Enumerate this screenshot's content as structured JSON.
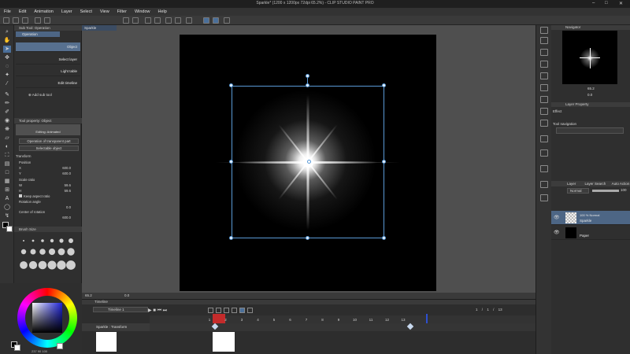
{
  "window": {
    "title": "Sparkle* (1200 x 1200px 72dpi 65.2%) - CLIP STUDIO PAINT PRO"
  },
  "menu": [
    "File",
    "Edit",
    "Animation",
    "Layer",
    "Select",
    "View",
    "Filter",
    "Window",
    "Help"
  ],
  "sub_tool": {
    "header": "Sub Tool: Operation",
    "tab": "Operation",
    "items": [
      "Object",
      "Select layer",
      "Light table",
      "Edit timeline"
    ],
    "add_label": "Add sub tool"
  },
  "tool_property": {
    "header": "Tool property: Object",
    "tab_label": "Editing: Animated",
    "transparent_op": "Operation of transparent part",
    "selectable": "Selectable object",
    "transform_label": "Transform",
    "position_label": "Position",
    "x_label": "X",
    "x_value": "600.0",
    "y_label": "Y",
    "y_value": "600.0",
    "scale_label": "Scale ratio",
    "w_label": "W",
    "w_value": "59.6",
    "h_label": "H",
    "h_value": "59.6",
    "keep_aspect": "Keep aspect ratio",
    "rotation_label": "Rotation angle",
    "rotation_value": "0.0",
    "center_label": "Center of rotation",
    "center_value": "600.0"
  },
  "brush_size": {
    "header": "Brush Size"
  },
  "color": {
    "hsv_readout": "237 90 100"
  },
  "canvas": {
    "tab": "Sparkle"
  },
  "canvas_status": {
    "zoom": "65.2",
    "angle": "0.0"
  },
  "timeline": {
    "header": "Timeline",
    "name": "Timeline 1",
    "track": "Sparkle : Transform",
    "frame_labels": [
      "1",
      "2",
      "3",
      "4",
      "5",
      "6",
      "7",
      "8",
      "9",
      "10",
      "11",
      "12",
      "13"
    ],
    "current_frame": "2",
    "right_fields": [
      "1",
      "/",
      "1",
      "/",
      "13"
    ],
    "end_frame": "13"
  },
  "navigator": {
    "header": "Navigator",
    "zoom": "65.2",
    "angle": "0.0"
  },
  "layer_property": {
    "header": "Layer Property",
    "effect": "Effect",
    "tool_navigation": "Tool navigation"
  },
  "layer_panel": {
    "tabs": [
      "Layer",
      "Layer Search",
      "Auto Action"
    ],
    "blend": "Normal",
    "opacity": "100",
    "layers": [
      {
        "meta": "100 % Normal",
        "name": "Sparkle"
      },
      {
        "meta": "",
        "name": "Paper"
      }
    ]
  },
  "colors": {
    "accent": "#5a9ad6",
    "selected_row": "#57708f",
    "playhead": "#c42b2b",
    "end_marker": "#2d4fd0"
  }
}
